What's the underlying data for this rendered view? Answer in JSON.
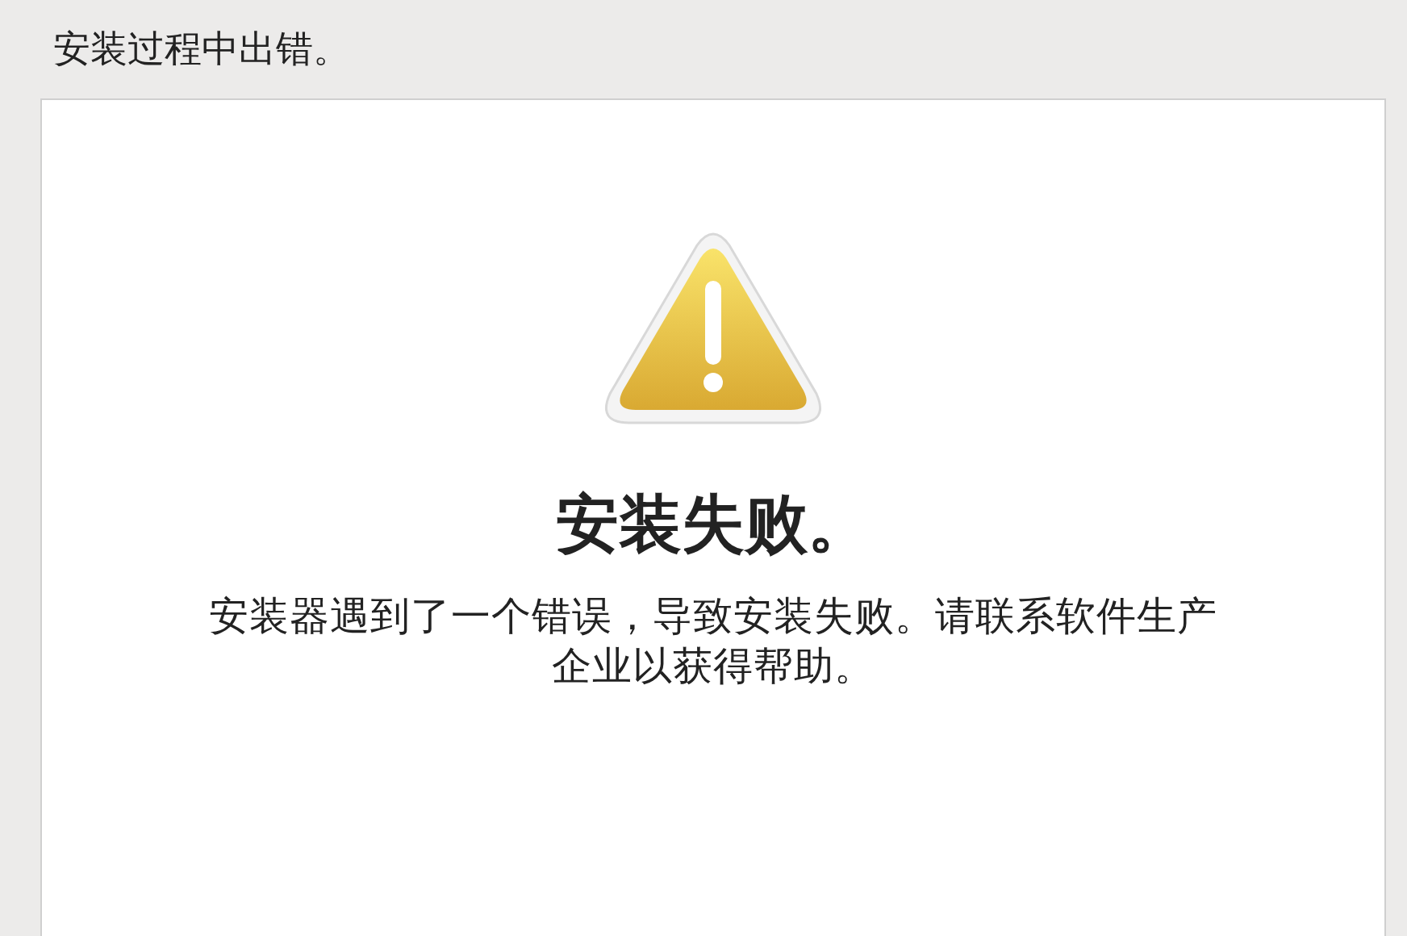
{
  "header": {
    "title": "安装过程中出错。"
  },
  "panel": {
    "heading": "安装失败。",
    "message": "安装器遇到了一个错误，导致安装失败。请联系软件生产企业以获得帮助。"
  }
}
